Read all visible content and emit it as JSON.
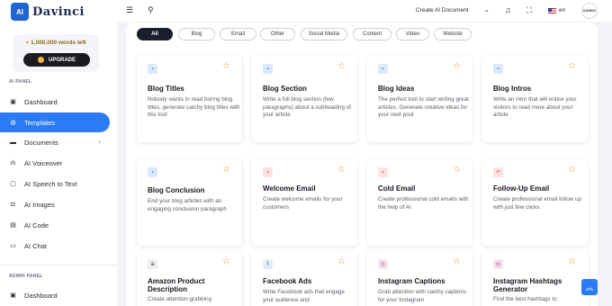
{
  "brand": {
    "logo_mark": "AI",
    "name": "Davinci"
  },
  "credits": {
    "text": "1,000,000 words left",
    "upgrade_label": "UPGRADE"
  },
  "sidebar": {
    "ai_panel_label": "AI PANEL",
    "admin_panel_label": "ADMIN PANEL",
    "items": [
      {
        "label": "Dashboard",
        "icon": "dashboard-icon"
      },
      {
        "label": "Templates",
        "icon": "templates-icon",
        "active": true
      },
      {
        "label": "Documents",
        "icon": "folder-icon"
      },
      {
        "label": "AI Voiceover",
        "icon": "waveform-icon"
      },
      {
        "label": "AI Speech to Text",
        "icon": "microphone-icon"
      },
      {
        "label": "AI Images",
        "icon": "image-icon"
      },
      {
        "label": "AI Code",
        "icon": "code-icon"
      },
      {
        "label": "AI Chat",
        "icon": "chat-icon"
      }
    ],
    "admin_items": [
      {
        "label": "Dashboard",
        "icon": "dashboard-icon"
      }
    ]
  },
  "topbar": {
    "create_label": "Create AI Document",
    "lang": "en",
    "avatar_text": "DAVINCI"
  },
  "filters": [
    "All",
    "Blog",
    "Email",
    "Other",
    "Social Media",
    "Content",
    "Video",
    "Website"
  ],
  "colors": {
    "accent": "#2a7bf5",
    "star": "#e59a2a",
    "dark_chip": "#1a1d2c"
  },
  "templates": [
    {
      "title": "Blog Titles",
      "desc": "Nobody wants to read boring blog titles, generate catchy blog titles with this tool",
      "icon": "blog-icon"
    },
    {
      "title": "Blog Section",
      "desc": "Write a full blog section (few paragraphs) about a subheading of your article",
      "icon": "blog-icon"
    },
    {
      "title": "Blog Ideas",
      "desc": "The perfect tool to start writing great articles. Generate creative ideas for your next post",
      "icon": "blog-icon"
    },
    {
      "title": "Blog Intros",
      "desc": "Write an intro that will entice your visitors to read more about your article",
      "icon": "blog-icon"
    },
    {
      "title": "Blog Conclusion",
      "desc": "End your blog articles with an engaging conclusion paragraph",
      "icon": "blog-icon"
    },
    {
      "title": "Welcome Email",
      "desc": "Create welcome emails for your customers",
      "icon": "email-icon"
    },
    {
      "title": "Cold Email",
      "desc": "Create professional cold emails with the help of AI",
      "icon": "email-icon"
    },
    {
      "title": "Follow-Up Email",
      "desc": "Create professional email follow up with just few clicks",
      "icon": "reply-icon"
    },
    {
      "title": "Amazon Product Description",
      "desc": "Create attention grabbing",
      "icon": "amazon-icon"
    },
    {
      "title": "Facebook Ads",
      "desc": "Write Facebook ads that engage your audience and",
      "icon": "facebook-icon"
    },
    {
      "title": "Instagram Captions",
      "desc": "Grab attention with catchy captions for your Instagram",
      "icon": "instagram-icon"
    },
    {
      "title": "Instagram Hashtags Generator",
      "desc": "Find the best hashtags to",
      "icon": "instagram-icon"
    }
  ]
}
